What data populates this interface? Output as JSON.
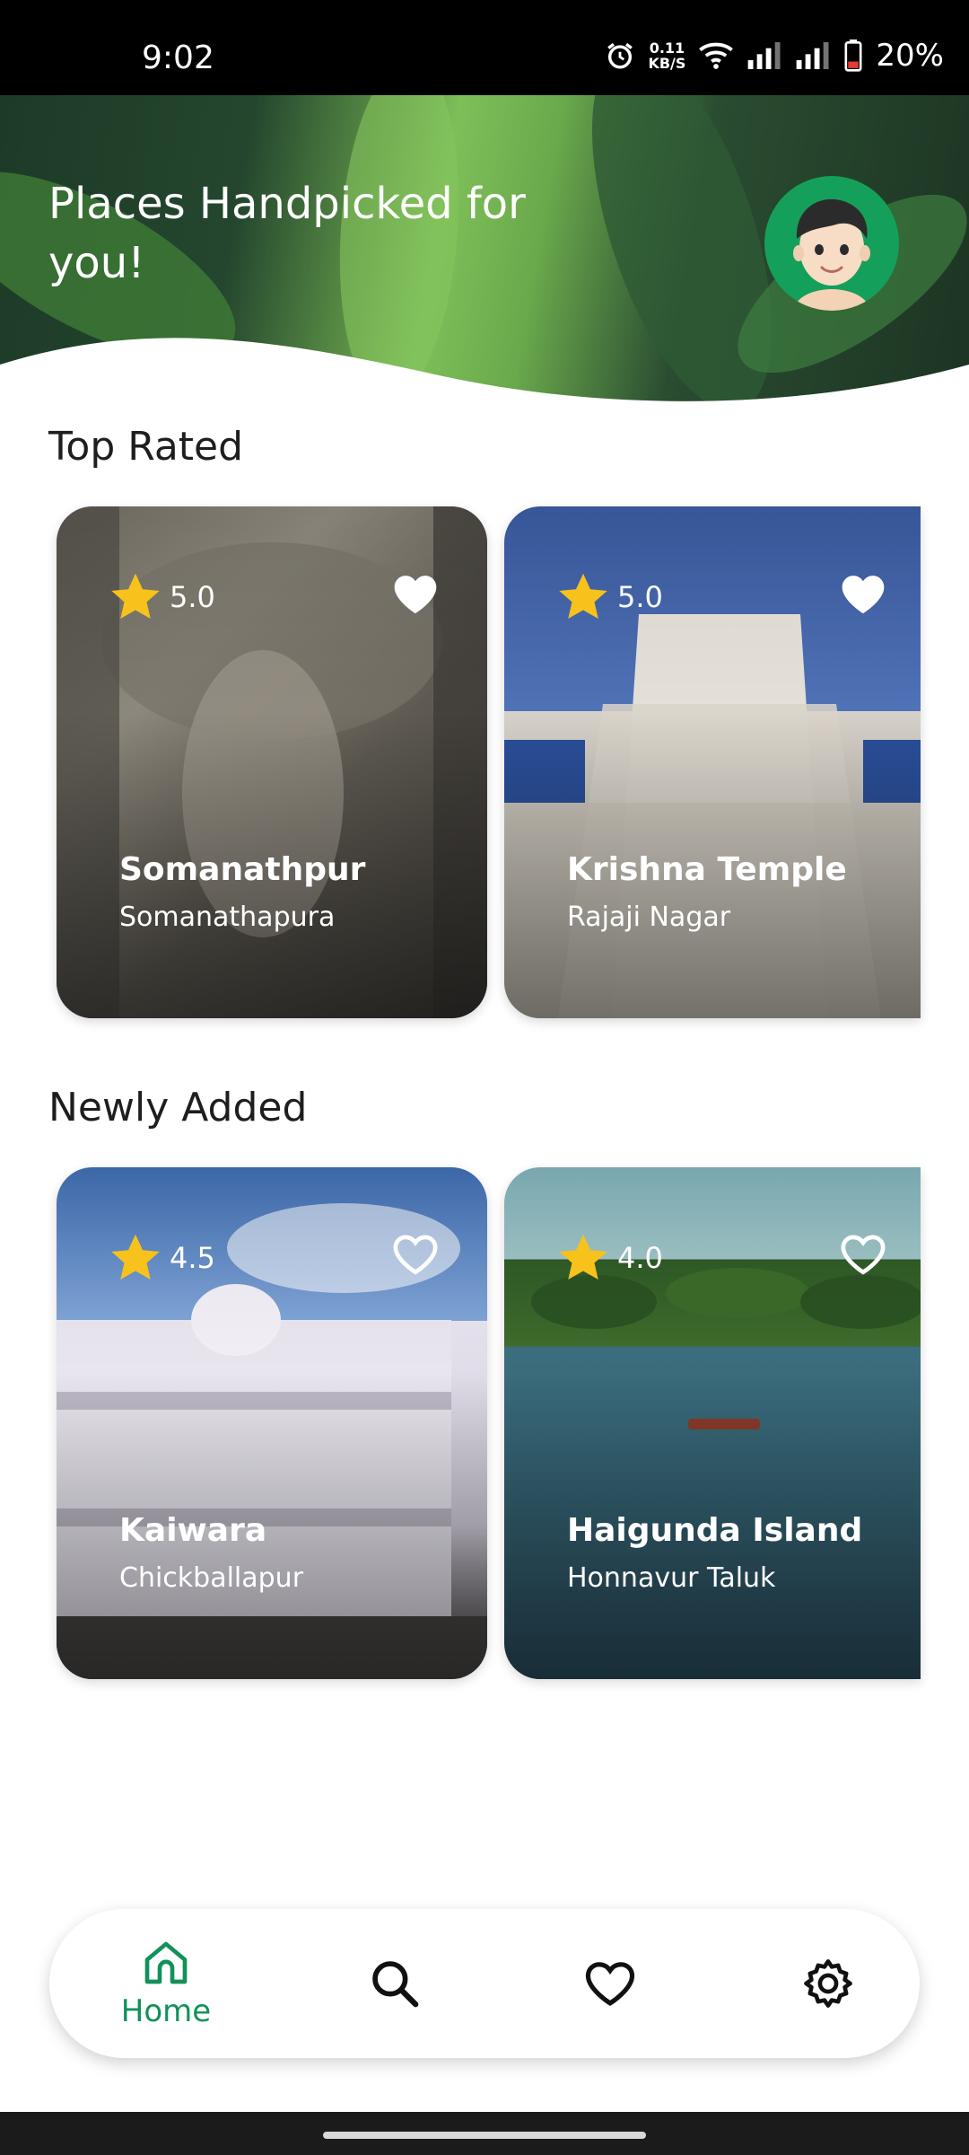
{
  "status_bar": {
    "time": "9:02",
    "net_speed_value": "0.11",
    "net_speed_unit": "KB/S",
    "battery": "20%"
  },
  "header": {
    "title": "Places Handpicked for you!",
    "avatar_icon": "memoji-avatar"
  },
  "sections": {
    "top_rated": {
      "title": "Top Rated",
      "cards": [
        {
          "name": "Somanathpur",
          "location": "Somanathapura",
          "rating": "5.0",
          "favorited": true
        },
        {
          "name": "Krishna Temple",
          "location": "Rajaji Nagar",
          "rating": "5.0",
          "favorited": true
        }
      ]
    },
    "newly_added": {
      "title": "Newly Added",
      "cards": [
        {
          "name": "Kaiwara",
          "location": "Chickballapur",
          "rating": "4.5",
          "favorited": false
        },
        {
          "name": "Haigunda Island",
          "location": "Honnavur Taluk",
          "rating": "4.0",
          "favorited": false
        }
      ]
    }
  },
  "bottom_nav": {
    "items": [
      {
        "icon": "home-icon",
        "label": "Home",
        "active": true
      },
      {
        "icon": "search-icon",
        "label": "",
        "active": false
      },
      {
        "icon": "heart-icon",
        "label": "",
        "active": false
      },
      {
        "icon": "gear-icon",
        "label": "",
        "active": false
      }
    ]
  },
  "colors": {
    "accent": "#12915a",
    "star": "#f7c21b",
    "avatar_bg": "#14a05a"
  }
}
